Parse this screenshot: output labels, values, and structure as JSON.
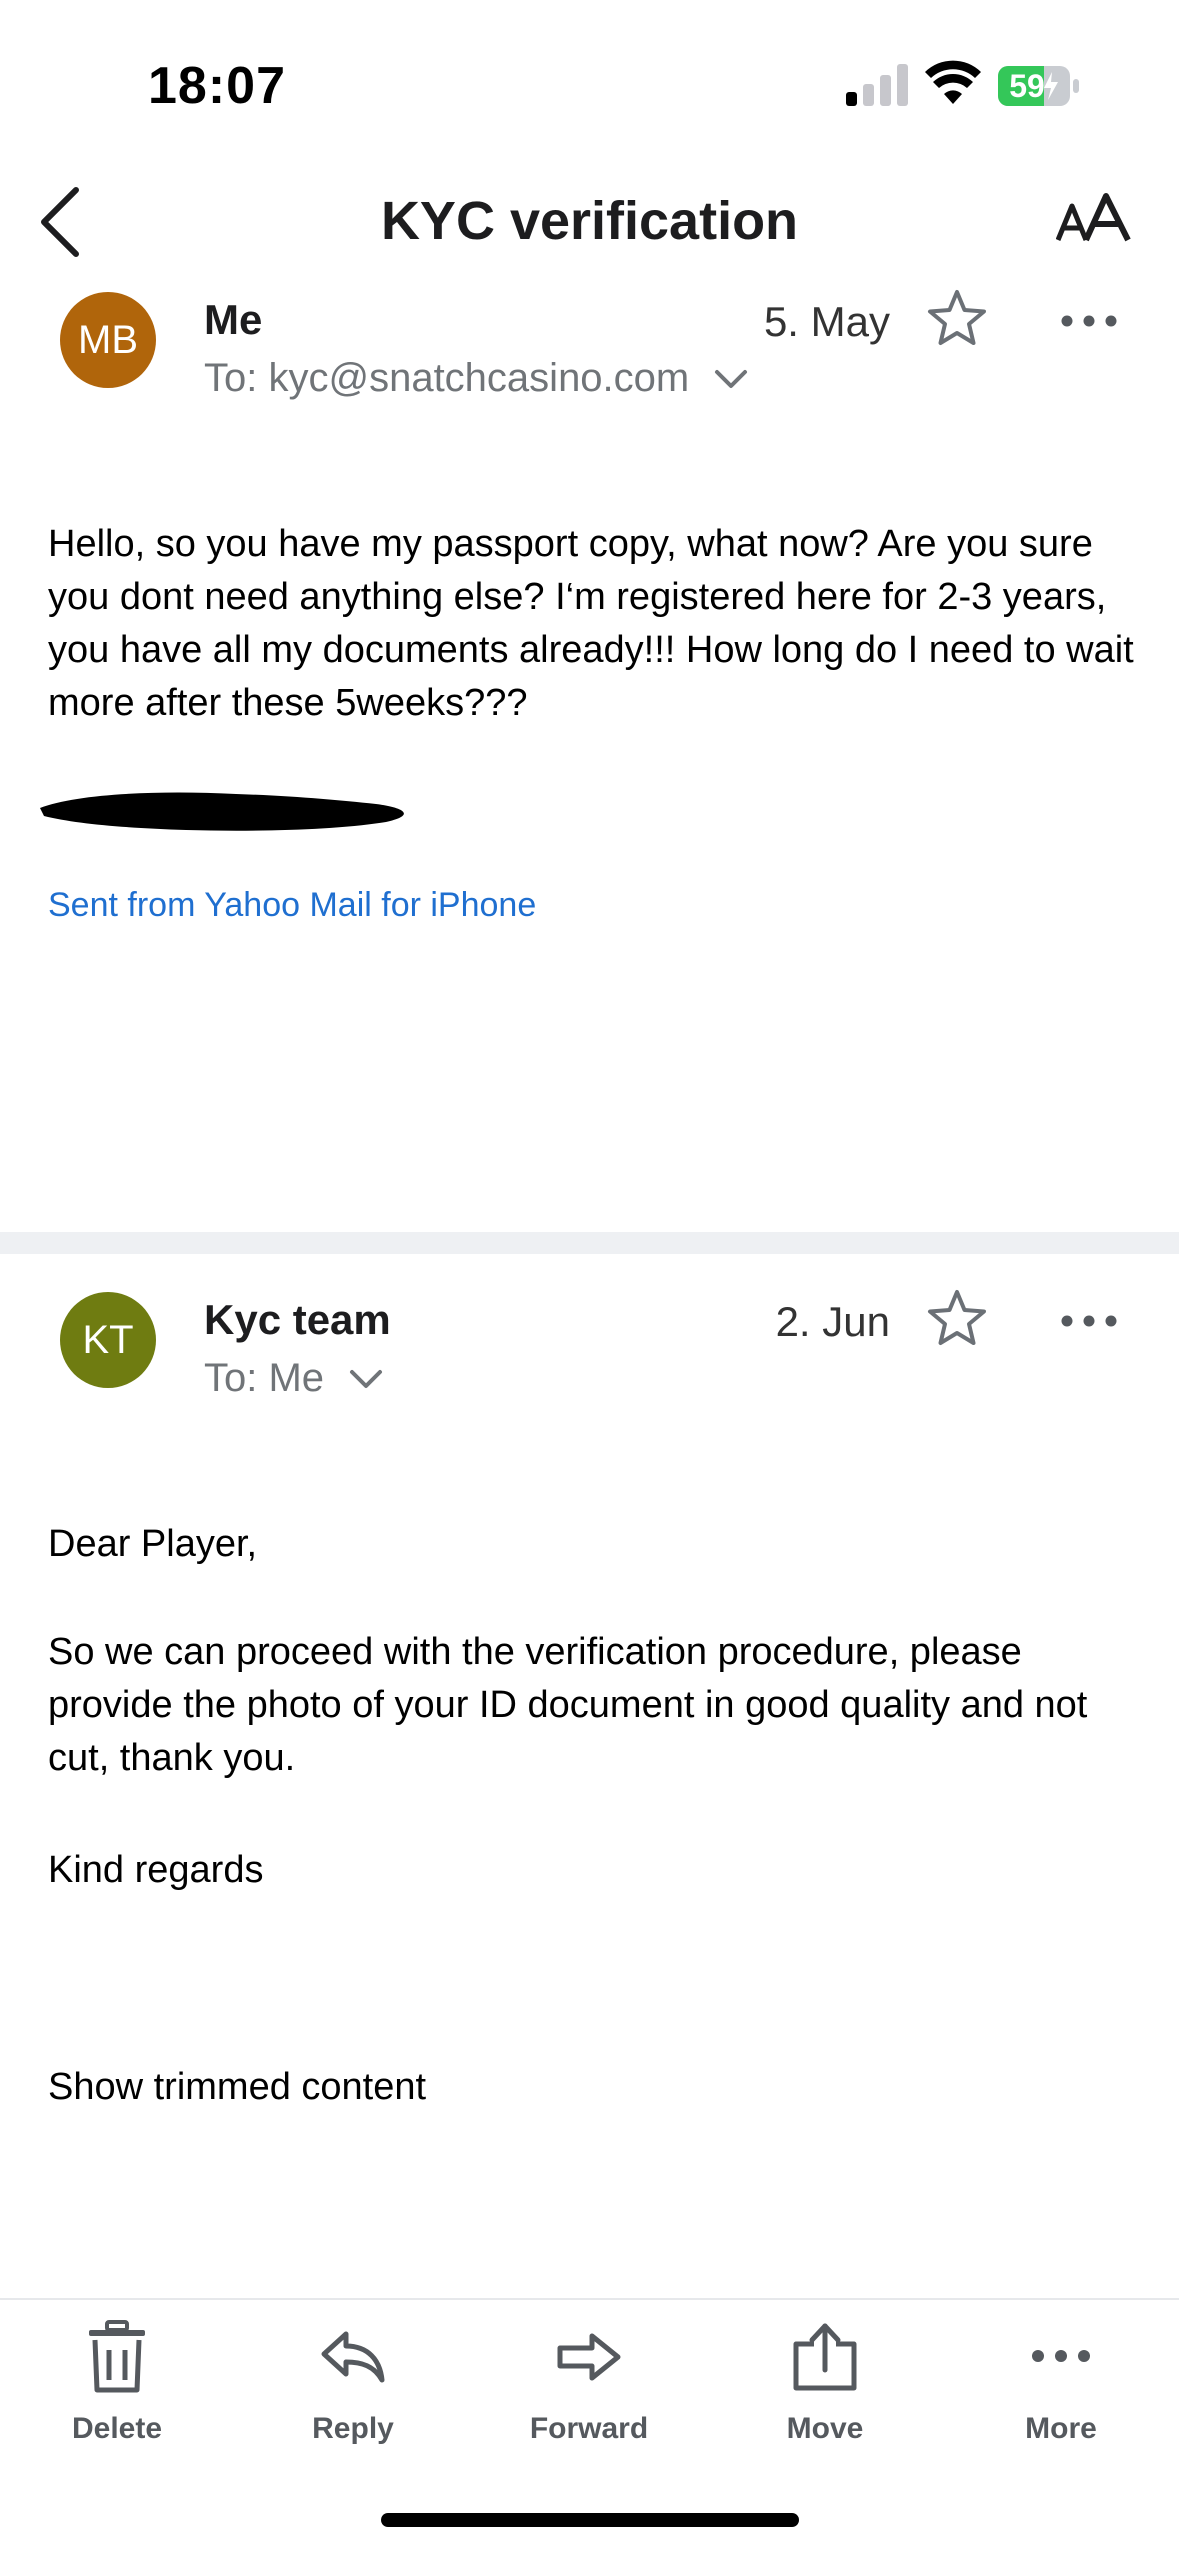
{
  "status_bar": {
    "time": "18:07",
    "battery_percent": "59"
  },
  "nav": {
    "title": "KYC verification"
  },
  "messages": [
    {
      "avatar_initials": "MB",
      "avatar_color": "#b0650b",
      "sender": "Me",
      "recipient": "To: kyc@snatchcasino.com",
      "date": "5. May",
      "body": [
        "Hello, so you have my passport copy, what now? Are you sure you dont need anything else? I‘m registered here for 2-3 years, you have all my documents already!!! How long do I need to wait more after these 5weeks???"
      ],
      "signature_link": "Sent from Yahoo Mail for iPhone"
    },
    {
      "avatar_initials": "KT",
      "avatar_color": "#6f7c11",
      "sender": "Kyc team",
      "recipient": "To: Me",
      "date": "2. Jun",
      "body": [
        "Dear Player,",
        "So we can proceed with the verification procedure, please provide the photo of your ID document in good quality and not cut, thank you.",
        "Kind regards"
      ],
      "trimmed_link": "Show trimmed content"
    }
  ],
  "toolbar": {
    "delete": "Delete",
    "reply": "Reply",
    "forward": "Forward",
    "move": "Move",
    "more": "More"
  },
  "colors": {
    "link": "#1f6fd0",
    "battery": "#34c759"
  }
}
